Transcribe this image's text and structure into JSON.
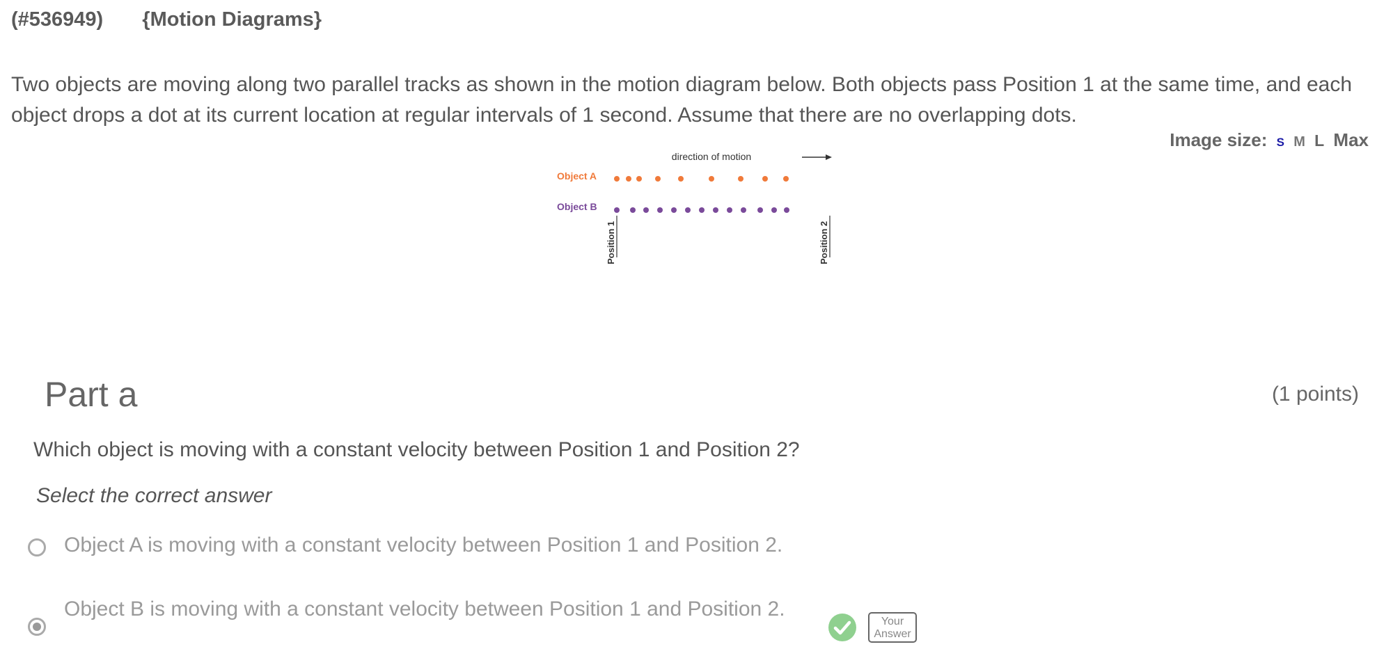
{
  "header": {
    "question_id": "(#536949)",
    "topic": "{Motion Diagrams}"
  },
  "intro_text": "Two objects are moving along two parallel tracks as shown in the motion diagram below.  Both objects pass Position 1 at the same time, and each object drops a dot at its current location at regular intervals of 1 second.  Assume that there are no overlapping dots.",
  "image_size": {
    "label": "Image size:",
    "options": [
      "S",
      "M",
      "L",
      "Max"
    ],
    "selected": "S"
  },
  "diagram": {
    "direction_label": "direction of motion",
    "object_a_label": "Object A",
    "object_b_label": "Object B",
    "position1_label": "Position 1",
    "position2_label": "Position 2",
    "colors": {
      "object_a": "#f07a3a",
      "object_b": "#7a4a9a"
    }
  },
  "part": {
    "title": "Part a",
    "points": "(1 points)",
    "prompt": "Which object is moving with a constant velocity between Position 1 and Position 2?",
    "instruction": "Select the correct answer",
    "options": [
      {
        "text": "Object A is moving with a constant velocity between Position 1 and Position 2.",
        "selected": false
      },
      {
        "text": "Object B is moving with a constant velocity between Position 1 and Position 2.",
        "selected": true
      }
    ],
    "your_answer_badge": "Your Answer"
  }
}
